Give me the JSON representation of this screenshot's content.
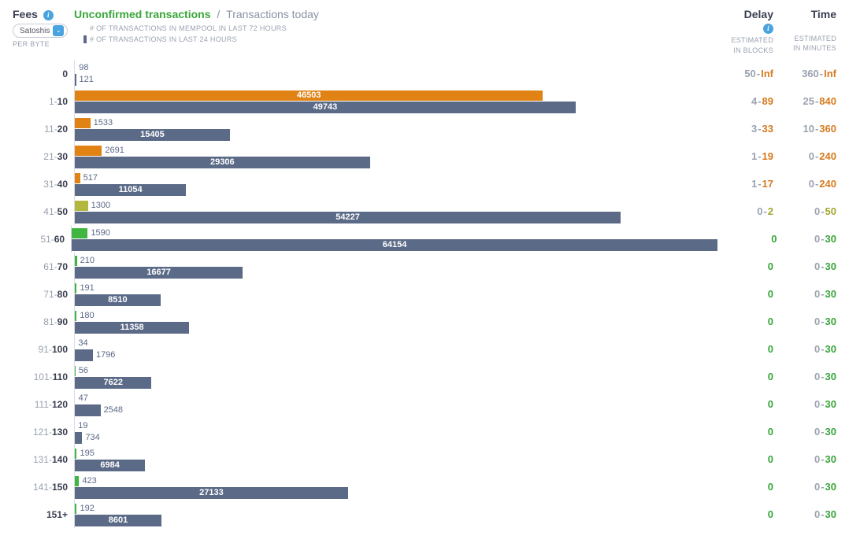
{
  "header": {
    "fees_label": "Fees",
    "tab_active": "Unconfirmed transactions",
    "tab_sep": "/",
    "tab_inactive": "Transactions today",
    "delay_label": "Delay",
    "time_label": "Time"
  },
  "subheader": {
    "unit_selected": "Satoshis",
    "per_byte": "PER BYTE",
    "legend_72h": "# OF TRANSACTIONS IN MEMPOOL IN LAST 72 HOURS",
    "legend_24h": "# OF TRANSACTIONS IN LAST 24 HOURS",
    "delay_sub1": "ESTIMATED",
    "delay_sub2": "IN BLOCKS",
    "time_sub1": "ESTIMATED",
    "time_sub2": "IN MINUTES"
  },
  "chart_data": {
    "type": "bar",
    "x_max": 64154,
    "series": [
      {
        "name": "mempool_72h"
      },
      {
        "name": "tx_24h"
      }
    ],
    "rows": [
      {
        "fee_lo": "",
        "fee_hi": "0",
        "mempool": 98,
        "mempool_color": "none",
        "tx24": 121,
        "delay_lo": "50",
        "delay_hi": "Inf",
        "delay_color": "orange",
        "time_lo": "360",
        "time_hi": "Inf",
        "time_color": "orange"
      },
      {
        "fee_lo": "1",
        "fee_hi": "10",
        "mempool": 46503,
        "mempool_color": "orange",
        "tx24": 49743,
        "delay_lo": "4",
        "delay_hi": "89",
        "delay_color": "orange",
        "time_lo": "25",
        "time_hi": "840",
        "time_color": "orange"
      },
      {
        "fee_lo": "11",
        "fee_hi": "20",
        "mempool": 1533,
        "mempool_color": "orange",
        "tx24": 15405,
        "delay_lo": "3",
        "delay_hi": "33",
        "delay_color": "orange",
        "time_lo": "10",
        "time_hi": "360",
        "time_color": "orange"
      },
      {
        "fee_lo": "21",
        "fee_hi": "30",
        "mempool": 2691,
        "mempool_color": "orange",
        "tx24": 29306,
        "delay_lo": "1",
        "delay_hi": "19",
        "delay_color": "orange",
        "time_lo": "0",
        "time_hi": "240",
        "time_color": "orange"
      },
      {
        "fee_lo": "31",
        "fee_hi": "40",
        "mempool": 517,
        "mempool_color": "orange",
        "tx24": 11054,
        "delay_lo": "1",
        "delay_hi": "17",
        "delay_color": "orange",
        "time_lo": "0",
        "time_hi": "240",
        "time_color": "orange"
      },
      {
        "fee_lo": "41",
        "fee_hi": "50",
        "mempool": 1300,
        "mempool_color": "olive",
        "tx24": 54227,
        "delay_lo": "0",
        "delay_hi": "2",
        "delay_color": "olive",
        "time_lo": "0",
        "time_hi": "50",
        "time_color": "olive"
      },
      {
        "fee_lo": "51",
        "fee_hi": "60",
        "mempool": 1590,
        "mempool_color": "green",
        "tx24": 64154,
        "delay_lo": "",
        "delay_hi": "0",
        "delay_color": "green",
        "time_lo": "0",
        "time_hi": "30",
        "time_color": "green"
      },
      {
        "fee_lo": "61",
        "fee_hi": "70",
        "mempool": 210,
        "mempool_color": "green",
        "tx24": 16677,
        "delay_lo": "",
        "delay_hi": "0",
        "delay_color": "green",
        "time_lo": "0",
        "time_hi": "30",
        "time_color": "green"
      },
      {
        "fee_lo": "71",
        "fee_hi": "80",
        "mempool": 191,
        "mempool_color": "green",
        "tx24": 8510,
        "delay_lo": "",
        "delay_hi": "0",
        "delay_color": "green",
        "time_lo": "0",
        "time_hi": "30",
        "time_color": "green"
      },
      {
        "fee_lo": "81",
        "fee_hi": "90",
        "mempool": 180,
        "mempool_color": "green",
        "tx24": 11358,
        "delay_lo": "",
        "delay_hi": "0",
        "delay_color": "green",
        "time_lo": "0",
        "time_hi": "30",
        "time_color": "green"
      },
      {
        "fee_lo": "91",
        "fee_hi": "100",
        "mempool": 34,
        "mempool_color": "none",
        "tx24": 1796,
        "delay_lo": "",
        "delay_hi": "0",
        "delay_color": "green",
        "time_lo": "0",
        "time_hi": "30",
        "time_color": "green"
      },
      {
        "fee_lo": "101",
        "fee_hi": "110",
        "mempool": 56,
        "mempool_color": "green",
        "tx24": 7622,
        "delay_lo": "",
        "delay_hi": "0",
        "delay_color": "green",
        "time_lo": "0",
        "time_hi": "30",
        "time_color": "green"
      },
      {
        "fee_lo": "111",
        "fee_hi": "120",
        "mempool": 47,
        "mempool_color": "none",
        "tx24": 2548,
        "delay_lo": "",
        "delay_hi": "0",
        "delay_color": "green",
        "time_lo": "0",
        "time_hi": "30",
        "time_color": "green"
      },
      {
        "fee_lo": "121",
        "fee_hi": "130",
        "mempool": 19,
        "mempool_color": "none",
        "tx24": 734,
        "delay_lo": "",
        "delay_hi": "0",
        "delay_color": "green",
        "time_lo": "0",
        "time_hi": "30",
        "time_color": "green"
      },
      {
        "fee_lo": "131",
        "fee_hi": "140",
        "mempool": 195,
        "mempool_color": "green",
        "tx24": 6984,
        "delay_lo": "",
        "delay_hi": "0",
        "delay_color": "green",
        "time_lo": "0",
        "time_hi": "30",
        "time_color": "green"
      },
      {
        "fee_lo": "141",
        "fee_hi": "150",
        "mempool": 423,
        "mempool_color": "green",
        "tx24": 27133,
        "delay_lo": "",
        "delay_hi": "0",
        "delay_color": "green",
        "time_lo": "0",
        "time_hi": "30",
        "time_color": "green"
      },
      {
        "fee_lo": "",
        "fee_hi": "151+",
        "mempool": 192,
        "mempool_color": "green",
        "tx24": 8601,
        "delay_lo": "",
        "delay_hi": "0",
        "delay_color": "green",
        "time_lo": "0",
        "time_hi": "30",
        "time_color": "green"
      }
    ]
  }
}
